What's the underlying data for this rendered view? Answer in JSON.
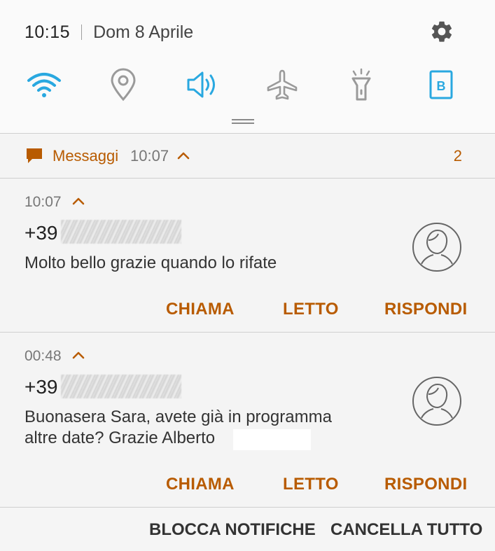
{
  "status": {
    "time": "10:15",
    "date": "Dom 8 Aprile"
  },
  "quick_settings": {
    "items": [
      {
        "name": "wifi-icon",
        "active": true
      },
      {
        "name": "location-icon",
        "active": false
      },
      {
        "name": "sound-icon",
        "active": true
      },
      {
        "name": "airplane-icon",
        "active": false
      },
      {
        "name": "flashlight-icon",
        "active": false
      },
      {
        "name": "blue-light-icon",
        "active": true,
        "glyph": "B"
      }
    ]
  },
  "app_group": {
    "app_name": "Messaggi",
    "time": "10:07",
    "count": "2"
  },
  "notifications": [
    {
      "time": "10:07",
      "sender_prefix": "+39",
      "body_line1": "Molto bello grazie quando lo rifate",
      "body_line2": "",
      "actions": {
        "call": "CHIAMA",
        "read": "LETTO",
        "reply": "RISPONDI"
      }
    },
    {
      "time": "00:48",
      "sender_prefix": "+39",
      "body_line1": "Buonasera Sara, avete già in programma",
      "body_line2": "altre date? Grazie Alberto",
      "actions": {
        "call": "CHIAMA",
        "read": "LETTO",
        "reply": "RISPONDI"
      }
    }
  ],
  "bottom_bar": {
    "block": "BLOCCA NOTIFICHE",
    "clear_all": "CANCELLA TUTTO"
  },
  "colors": {
    "accent": "#b85b00",
    "active_icon": "#29a8e0",
    "inactive_icon": "#9a9a9a"
  }
}
